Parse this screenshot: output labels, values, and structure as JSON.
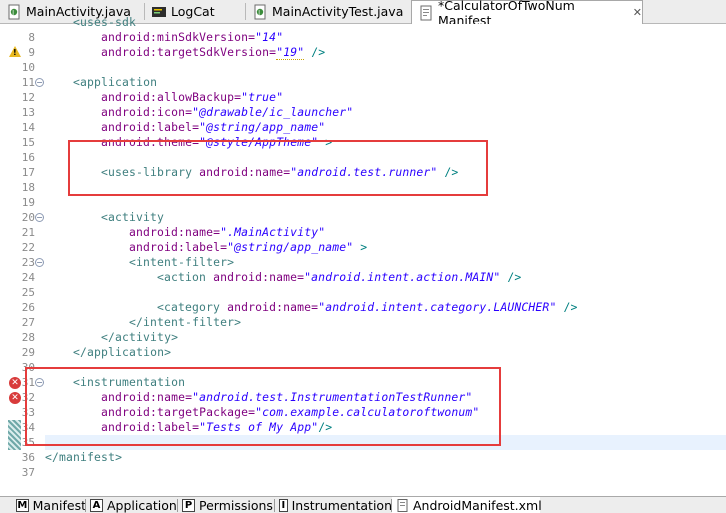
{
  "tabs": [
    {
      "label": "MainActivity.java",
      "icon": "java-file-icon"
    },
    {
      "label": "LogCat",
      "icon": "logcat-icon"
    },
    {
      "label": "MainActivityTest.java",
      "icon": "java-file-icon"
    },
    {
      "label": "*CalculatorOfTwoNum Manifest",
      "icon": "manifest-icon",
      "close": "✕"
    }
  ],
  "gutter": {
    "line_numbers": [
      "8",
      "9",
      "10",
      "11",
      "12",
      "13",
      "14",
      "15",
      "16",
      "17",
      "18",
      "19",
      "20",
      "21",
      "22",
      "23",
      "24",
      "25",
      "26",
      "27",
      "28",
      "29",
      "30",
      "31",
      "32",
      "33",
      "34",
      "35",
      "36",
      "37"
    ]
  },
  "code": {
    "l7": {
      "tag": "<uses-sdk"
    },
    "l8": {
      "attr": "android:minSdkVersion=",
      "val": "\"14\""
    },
    "l9": {
      "attr": "android:targetSdkVersion=",
      "val": "\"19\"",
      "close": " />"
    },
    "l11": {
      "tag": "<application"
    },
    "l12": {
      "attr": "android:allowBackup=",
      "val": "\"true\""
    },
    "l13": {
      "attr": "android:icon=",
      "val": "\"@drawable/ic_launcher\""
    },
    "l14": {
      "attr": "android:label=",
      "val": "\"@string/app_name\""
    },
    "l15": {
      "attr": "android:theme=",
      "val": "\"@style/AppTheme\"",
      "close": " >"
    },
    "l17": {
      "tag": "<uses-library",
      "attr": " android:name=",
      "val": "\"android.test.runner\"",
      "close": " />"
    },
    "l20": {
      "tag": "<activity"
    },
    "l21": {
      "attr": "android:name=",
      "val": "\".MainActivity\""
    },
    "l22": {
      "attr": "android:label=",
      "val": "\"@string/app_name\"",
      "close": " >"
    },
    "l23": {
      "tag": "<intent-filter>"
    },
    "l24": {
      "tag": "<action",
      "attr": " android:name=",
      "val": "\"android.intent.action.MAIN\"",
      "close": " />"
    },
    "l26": {
      "tag": "<category",
      "attr": " android:name=",
      "val": "\"android.intent.category.LAUNCHER\"",
      "close": " />"
    },
    "l27": {
      "tag": "</intent-filter>"
    },
    "l28": {
      "tag": "</activity>"
    },
    "l29": {
      "tag": "</application>"
    },
    "l31": {
      "tag": "<instrumentation"
    },
    "l32": {
      "attr": "android:name=",
      "val": "\"android.test.InstrumentationTestRunner\""
    },
    "l33": {
      "attr": "android:targetPackage=",
      "val": "\"com.example.calculatoroftwonum\""
    },
    "l34": {
      "attr": "android:label=",
      "val": "\"Tests of My App\"",
      "close": "/>"
    },
    "l36": {
      "tag": "</manifest>"
    }
  },
  "markers": {
    "warning": "!",
    "error": "✕",
    "fold": "−"
  },
  "bottom_tabs": [
    {
      "label": "Manifest",
      "icon": "M"
    },
    {
      "label": "Application",
      "icon": "A"
    },
    {
      "label": "Permissions",
      "icon": "P"
    },
    {
      "label": "Instrumentation",
      "icon": "I"
    },
    {
      "label": "AndroidManifest.xml",
      "icon": "xml"
    }
  ],
  "colors": {
    "highlight_box": "#e53c3c",
    "tag": "#3f7f7f",
    "attribute": "#7f007f",
    "value": "#2a00ff"
  }
}
